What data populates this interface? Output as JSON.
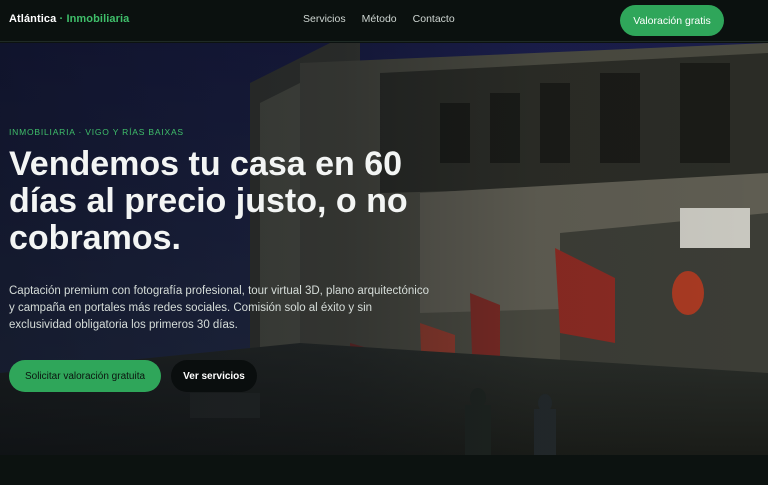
{
  "brand": {
    "name": "Atlántica",
    "separator": "·",
    "accent": "Inmobiliaria"
  },
  "nav": {
    "links": [
      "Servicios",
      "Método",
      "Contacto"
    ],
    "cta": "Valoración gratis"
  },
  "hero": {
    "eyebrow": "INMOBILIARIA · VIGO Y RÍAS BAIXAS",
    "headline": "Vendemos tu casa en 60 días al precio justo, o no cobramos.",
    "subtext": "Captación premium con fotografía profesional, tour virtual 3D, plano arquitectónico y campaña en portales más redes sociales. Comisión solo al éxito y sin exclusividad obligatoria los primeros 30 días.",
    "primary_button": "Solicitar valoración gratuita",
    "secondary_button": "Ver servicios",
    "background_image": "street-photo"
  },
  "colors": {
    "accent": "#2fa65a",
    "background": "#0c1210"
  }
}
